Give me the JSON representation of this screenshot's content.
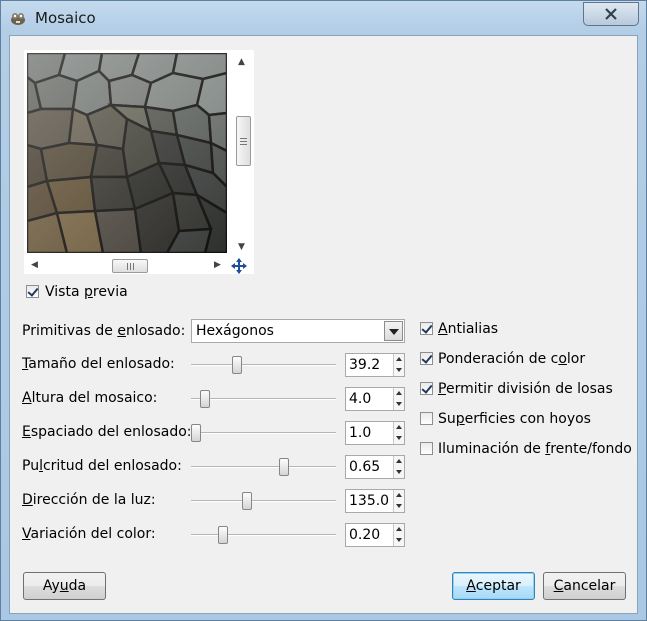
{
  "window": {
    "title": "Mosaico",
    "close_label": "✕"
  },
  "preview": {
    "checkbox_label_pre": "Vista ",
    "checkbox_label_accel": "p",
    "checkbox_label_post": "revia",
    "checked": true
  },
  "options": {
    "primitive": {
      "label_pre": "Primitivas de ",
      "label_accel": "e",
      "label_post": "nlosado:",
      "value": "Hexágonos"
    },
    "sliders": [
      {
        "pre": "",
        "accel": "T",
        "post": "amaño del enlosado:",
        "value": "39.2",
        "level": 0.3
      },
      {
        "pre": "",
        "accel": "A",
        "post": "ltura del mosaico:",
        "value": "4.0",
        "level": 0.07
      },
      {
        "pre": "",
        "accel": "E",
        "post": "spaciado del enlosado:",
        "value": "1.0",
        "level": 0.0
      },
      {
        "pre": "Pu",
        "accel": "l",
        "post": "critud del enlosado:",
        "value": "0.65",
        "level": 0.65
      },
      {
        "pre": "",
        "accel": "D",
        "post": "irección de la luz:",
        "value": "135.0",
        "level": 0.38
      },
      {
        "pre": "",
        "accel": "V",
        "post": "ariación del color:",
        "value": "0.20",
        "level": 0.2
      }
    ],
    "checks": [
      {
        "pre": "",
        "accel": "A",
        "post": "ntialias",
        "checked": true
      },
      {
        "pre": "Ponderación de c",
        "accel": "o",
        "post": "lor",
        "checked": true
      },
      {
        "pre": "",
        "accel": "P",
        "post": "ermitir división de losas",
        "checked": true
      },
      {
        "pre": "Su",
        "accel": "p",
        "post": "erficies con hoyos",
        "checked": false
      },
      {
        "pre": "Iluminación de ",
        "accel": "f",
        "post": "rente/fondo",
        "checked": false
      }
    ]
  },
  "buttons": {
    "help_pre": "Ay",
    "help_accel": "u",
    "help_post": "da",
    "ok_pre": "",
    "ok_accel": "A",
    "ok_post": "ceptar",
    "cancel_pre": "",
    "cancel_accel": "C",
    "cancel_post": "ancelar"
  },
  "colors": {
    "title_bar": "#b3cde6",
    "dialog_bg": "#f0f0f0",
    "default_button": "#bee6fd"
  },
  "icons": {
    "app": "gimp-icon",
    "close": "close-icon",
    "pan": "move-arrows-icon"
  }
}
